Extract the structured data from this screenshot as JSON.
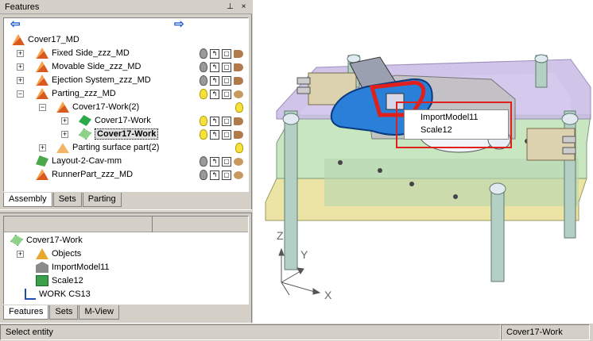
{
  "features_panel": {
    "title": "Features",
    "pin_glyph": "⊥",
    "close_glyph": "×",
    "nav_back_icon": "arrow-left-icon",
    "nav_forward_icon": "arrow-right-icon",
    "tree": [
      {
        "label": "Cover17_MD",
        "icon": "assembly-icon"
      },
      {
        "label": "Fixed Side_zzz_MD",
        "icon": "assembly-icon"
      },
      {
        "label": "Movable Side_zzz_MD",
        "icon": "assembly-icon"
      },
      {
        "label": "Ejection System_zzz_MD",
        "icon": "assembly-icon"
      },
      {
        "label": "Parting_zzz_MD",
        "icon": "assembly-icon"
      },
      {
        "label": "Cover17-Work(2)",
        "icon": "assembly-icon"
      },
      {
        "label": "Cover17-Work",
        "icon": "part-icon"
      },
      {
        "label": "Cover17-Work",
        "icon": "part-icon",
        "selected": true
      },
      {
        "label": "Parting surface part(2)",
        "icon": "surface-icon"
      },
      {
        "label": "Layout-2-Cav-mm",
        "icon": "layout-icon"
      },
      {
        "label": "RunnerPart_zzz_MD",
        "icon": "assembly-icon"
      }
    ],
    "tabs": [
      "Assembly",
      "Sets",
      "Parting"
    ]
  },
  "lower_panel": {
    "tree": [
      {
        "label": "Cover17-Work",
        "icon": "part-icon"
      },
      {
        "label": "Objects",
        "icon": "objects-icon"
      },
      {
        "label": "ImportModel11",
        "icon": "import-icon"
      },
      {
        "label": "Scale12",
        "icon": "scale-icon"
      },
      {
        "label": "WORK CS13",
        "icon": "csys-icon"
      }
    ],
    "tabs": [
      "Features",
      "Sets",
      "M-View"
    ]
  },
  "viewport": {
    "popup_items": [
      "ImportModel11",
      "Scale12"
    ],
    "axis_labels": {
      "z": "Z",
      "y": "Y",
      "x": "X"
    }
  },
  "status_bar": {
    "message": "Select entity",
    "active_part": "Cover17-Work"
  },
  "colors": {
    "highlight_red": "#e0201c",
    "part_blue": "#2a7fd8",
    "mold_purple": "#b6a6d8",
    "mold_green": "#b8e0b0",
    "mold_yellow": "#e8e0a0"
  }
}
